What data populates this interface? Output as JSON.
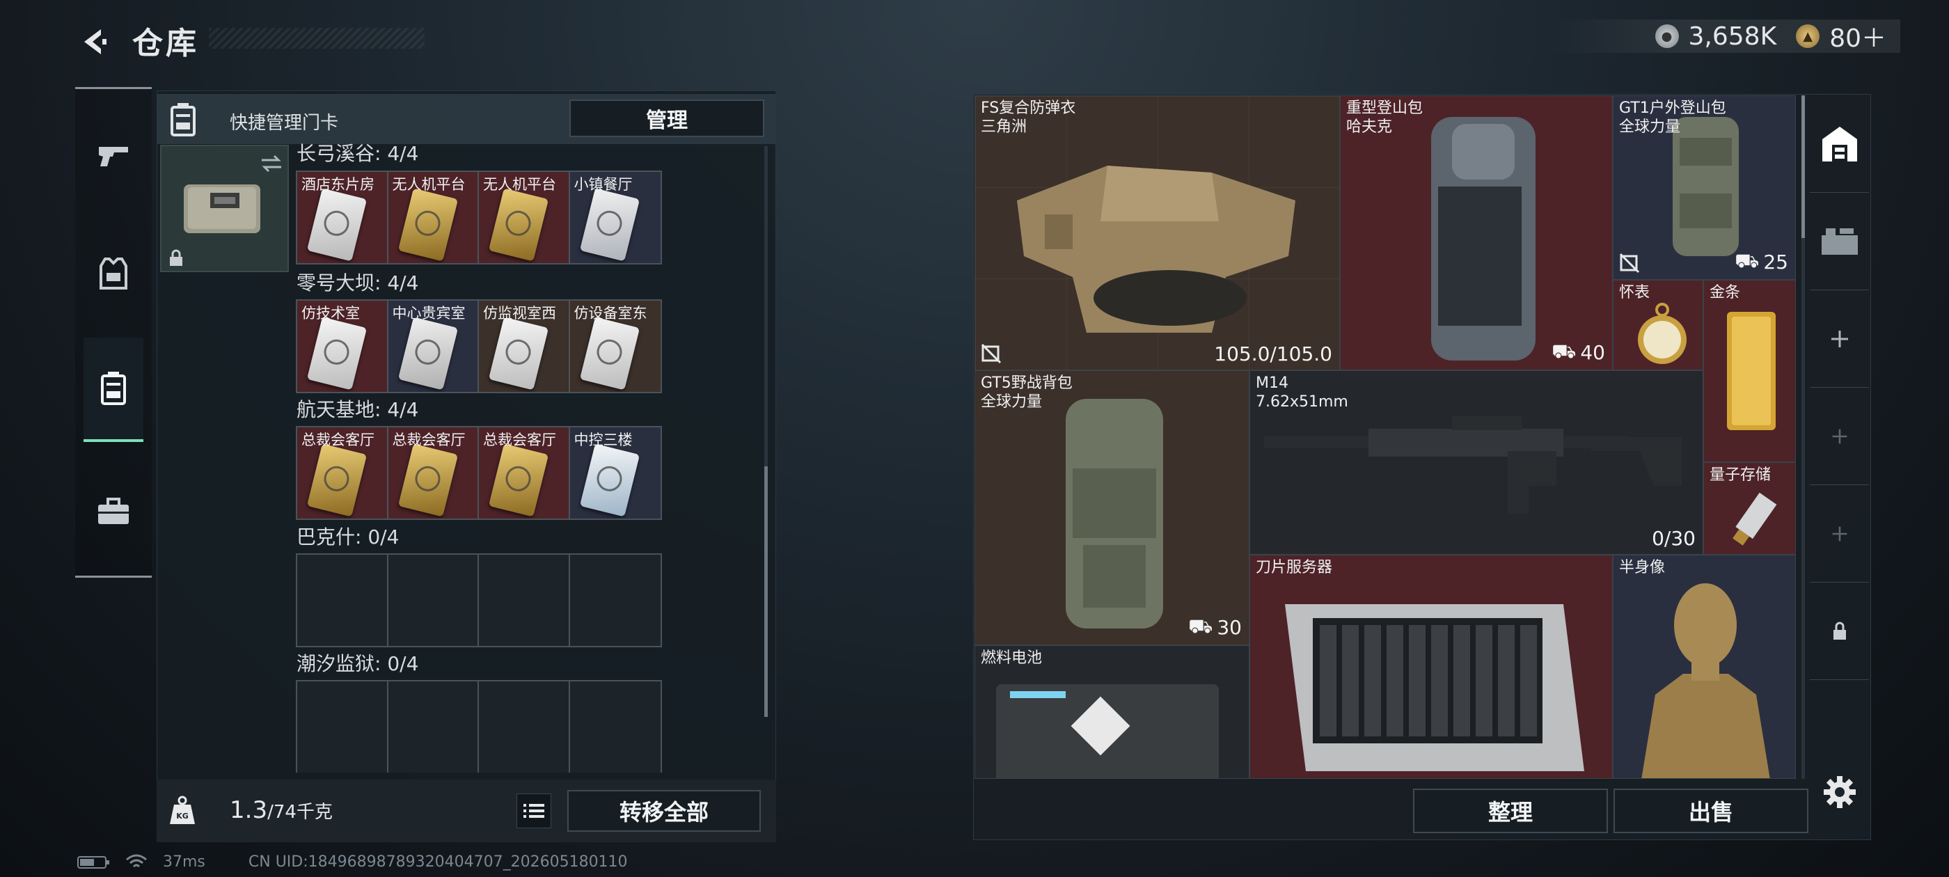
{
  "header": {
    "title": "仓库",
    "currency": {
      "coins": "3,658K",
      "tokens": "80＋"
    }
  },
  "left_panel": {
    "quick_manage_label": "快捷管理门卡",
    "manage_button": "管理",
    "groups": [
      {
        "title": "长弓溪谷: 4/4",
        "cards": [
          {
            "label": "酒店东片房",
            "color": "red-white"
          },
          {
            "label": "无人机平台",
            "color": "gold"
          },
          {
            "label": "无人机平台",
            "color": "gold"
          },
          {
            "label": "小镇餐厅",
            "color": "navy"
          }
        ]
      },
      {
        "title": "零号大坝: 4/4",
        "cards": [
          {
            "label": "仿技术室",
            "color": "white"
          },
          {
            "label": "中心贵宾室",
            "color": "navy"
          },
          {
            "label": "仿监视室西",
            "color": "white"
          },
          {
            "label": "仿设备室东",
            "color": "white"
          }
        ]
      },
      {
        "title": "航天基地: 4/4",
        "cards": [
          {
            "label": "总裁会客厅",
            "color": "gold"
          },
          {
            "label": "总裁会客厅",
            "color": "gold"
          },
          {
            "label": "总裁会客厅",
            "color": "gold"
          },
          {
            "label": "中控三楼",
            "color": "navy"
          }
        ]
      },
      {
        "title": "巴克什: 0/4",
        "cards": []
      },
      {
        "title": "潮汐监狱: 0/4",
        "cards": []
      }
    ],
    "weight": {
      "current": "1.3",
      "max": "/74千克"
    },
    "transfer_all_button": "转移全部"
  },
  "stash": {
    "items": [
      {
        "name": "FS复合防弹衣\n三角洲",
        "value": "105.0/105.0"
      },
      {
        "name": "重型登山包\n哈夫克",
        "value": "40"
      },
      {
        "name": "GT1户外登山包\n全球力量",
        "value": "25"
      },
      {
        "name": "怀表",
        "value": ""
      },
      {
        "name": "金条",
        "value": ""
      },
      {
        "name": "GT5野战背包\n全球力量",
        "value": "30"
      },
      {
        "name": "M14\n7.62x51mm",
        "value": "0/30"
      },
      {
        "name": "量子存储",
        "value": ""
      },
      {
        "name": "燃料电池",
        "value": ""
      },
      {
        "name": "刀片服务器",
        "value": ""
      },
      {
        "name": "半身像",
        "value": ""
      }
    ],
    "sort_button": "整理",
    "sell_button": "出售"
  },
  "status_bar": {
    "ping": "37ms",
    "uid": "CN UID:18496898789320404707_202605180110"
  },
  "colors": {
    "accent": "#7fe0b9",
    "slot_red": "#4d2328",
    "slot_brown": "#3b302a"
  }
}
